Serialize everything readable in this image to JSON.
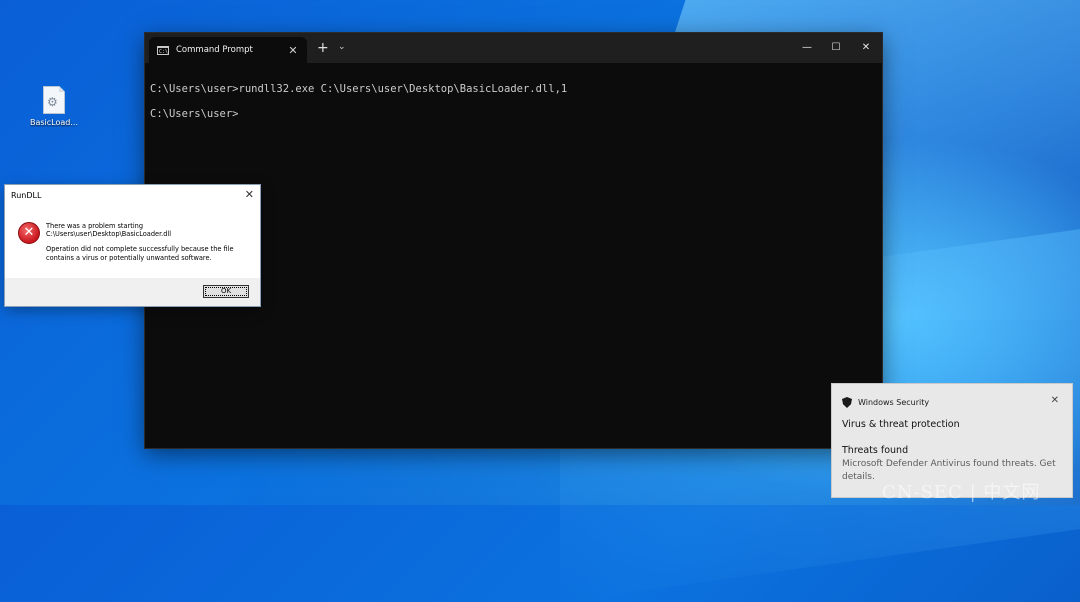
{
  "desktop": {
    "icon_label": "BasicLoad..."
  },
  "cmd": {
    "tab_title": "Command Prompt",
    "tab_icon_text": "C:\\",
    "new_tab": "+",
    "dropdown": "⌄",
    "close_tab": "✕",
    "minimize": "—",
    "maximize": "☐",
    "close": "✕",
    "lines": [
      "C:\\Users\\user>rundll32.exe C:\\Users\\user\\Desktop\\BasicLoader.dll,1",
      "C:\\Users\\user>"
    ]
  },
  "dialog": {
    "title": "RunDLL",
    "close": "✕",
    "error_glyph": "✕",
    "message_line1": "There was a problem starting",
    "message_line2": "C:\\Users\\user\\Desktop\\BasicLoader.dll",
    "detail_line1": "Operation did not complete successfully because the file",
    "detail_line2": "contains a virus or potentially unwanted software.",
    "ok_label": "OK"
  },
  "toast": {
    "app_name": "Windows Security",
    "close": "✕",
    "heading": "Virus & threat protection",
    "subheading": "Threats found",
    "body": "Microsoft Defender Antivirus found threats. Get details."
  },
  "watermark": "CN-SEC | 中文网",
  "colors": {
    "cmd_background": "#0c0c0c",
    "error_red": "#c8161c",
    "desktop_blue": "#0b72df"
  }
}
